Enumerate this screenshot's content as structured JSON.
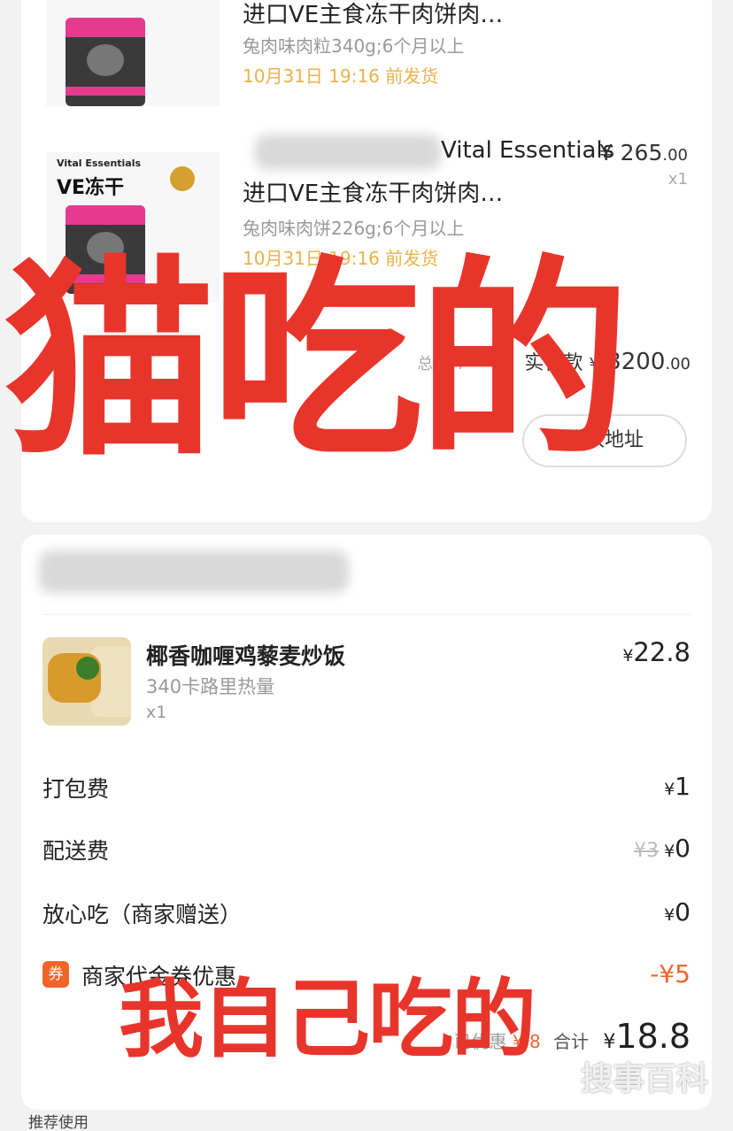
{
  "order1": {
    "products": [
      {
        "title_line1": "",
        "title_line2": "进口VE主食冻干肉饼肉…",
        "spec": "兔肉味肉粒340g;6个月以上",
        "ship": "10月31日 19:16 前发货",
        "price_symbol": "",
        "price_int": "",
        "price_dec": "",
        "qty": ""
      },
      {
        "title_line1": "Vital Essentials",
        "title_line2": "进口VE主食冻干肉饼肉…",
        "spec": "兔肉味肉饼226g;6个月以上",
        "ship": "10月31日 19:16 前发货",
        "price_symbol": "¥",
        "price_int": "265",
        "price_dec": ".00",
        "qty": "x1"
      }
    ],
    "image_brand_small": "Vital Essentials",
    "image_brand_big": "VE冻干",
    "total_label": "总价",
    "paid_label": "实付款",
    "paid_symbol": "¥",
    "paid_int": "3200",
    "paid_dec": ".00",
    "modify_address_label": "修改地址"
  },
  "overlay": {
    "top_text": "猫吃的",
    "bottom_text": "我自己吃的"
  },
  "order2": {
    "food": {
      "name": "椰香咖喱鸡藜麦炒饭",
      "calories": "340卡路里热量",
      "qty": "x1",
      "price_symbol": "¥",
      "price": "22.8"
    },
    "fees": [
      {
        "label": "打包费",
        "symbol": "¥",
        "value": "1",
        "strike": ""
      },
      {
        "label": "配送费",
        "symbol": "¥",
        "value": "0",
        "strike": "¥3"
      },
      {
        "label": "放心吃（商家赠送）",
        "symbol": "¥",
        "value": "0",
        "strike": ""
      }
    ],
    "coupon": {
      "icon_text": "券",
      "label": "商家代金券优惠",
      "value": "-¥5"
    },
    "discount_label": "已优惠",
    "total_label": "合计",
    "total_symbol": "¥",
    "total": "18.8"
  },
  "footer": {
    "recommend_label": "推荐使用"
  },
  "watermark": "搜事百科",
  "colors": {
    "overlay_red": "#e8352b",
    "ship_yellow": "#e8b34a",
    "coupon_orange": "#f0652a"
  }
}
